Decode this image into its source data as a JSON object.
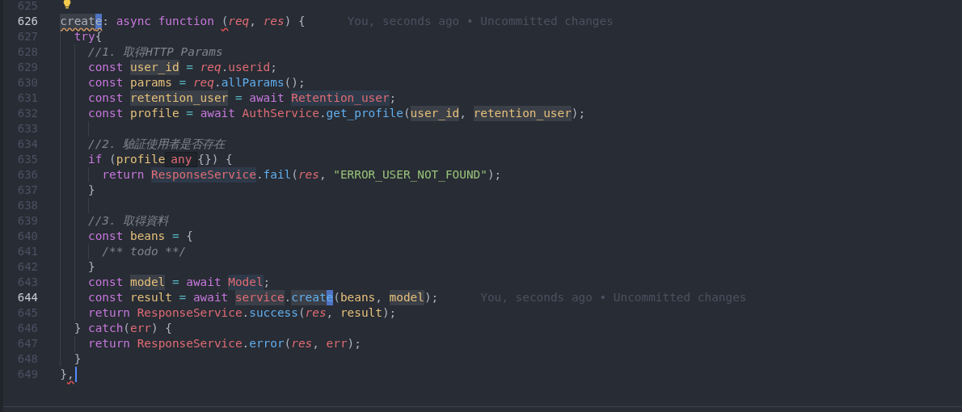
{
  "editor": {
    "lines": [
      {
        "number": "625",
        "current": false,
        "hint_icon": true
      },
      {
        "number": "626",
        "current": true,
        "tokens": [
          {
            "t": "  creat",
            "kind": "plain",
            "highlighted": true,
            "warning": true
          },
          {
            "t": "e",
            "kind": "plain",
            "selected": true,
            "warning": true
          },
          {
            "t": ": ",
            "kind": "plain"
          },
          {
            "t": "async ",
            "kind": "keyword"
          },
          {
            "t": "function ",
            "kind": "keyword"
          },
          {
            "t": "(",
            "kind": "plain",
            "error": true
          },
          {
            "t": "req",
            "kind": "param"
          },
          {
            "t": ", ",
            "kind": "plain"
          },
          {
            "t": "res",
            "kind": "param"
          },
          {
            "t": ") {",
            "kind": "plain"
          }
        ],
        "blame": "You, seconds ago • Uncommitted changes"
      },
      {
        "number": "627",
        "current": false,
        "tokens": [
          {
            "t": "    try",
            "kind": "keyword"
          },
          {
            "t": "{",
            "kind": "plain"
          }
        ]
      },
      {
        "number": "628",
        "current": false,
        "tokens": [
          {
            "t": "      //1. 取得HTTP Params",
            "kind": "comment"
          }
        ]
      },
      {
        "number": "629",
        "current": false,
        "tokens": [
          {
            "t": "      const ",
            "kind": "keyword"
          },
          {
            "t": "user_id",
            "kind": "variable",
            "highlighted": true
          },
          {
            "t": " = ",
            "kind": "operator"
          },
          {
            "t": "req",
            "kind": "param"
          },
          {
            "t": ".",
            "kind": "plain"
          },
          {
            "t": "userid",
            "kind": "property"
          },
          {
            "t": ";",
            "kind": "plain"
          }
        ]
      },
      {
        "number": "630",
        "current": false,
        "tokens": [
          {
            "t": "      const ",
            "kind": "keyword"
          },
          {
            "t": "params",
            "kind": "variable"
          },
          {
            "t": " = ",
            "kind": "operator"
          },
          {
            "t": "req",
            "kind": "param"
          },
          {
            "t": ".",
            "kind": "plain"
          },
          {
            "t": "allParams",
            "kind": "function"
          },
          {
            "t": "();",
            "kind": "plain"
          }
        ]
      },
      {
        "number": "631",
        "current": false,
        "tokens": [
          {
            "t": "      const ",
            "kind": "keyword"
          },
          {
            "t": "retention_user",
            "kind": "variable",
            "highlighted": true
          },
          {
            "t": " = ",
            "kind": "operator"
          },
          {
            "t": "await ",
            "kind": "keyword"
          },
          {
            "t": "Retention_user",
            "kind": "class",
            "highlighted": true
          },
          {
            "t": ";",
            "kind": "plain"
          }
        ]
      },
      {
        "number": "632",
        "current": false,
        "tokens": [
          {
            "t": "      const ",
            "kind": "keyword"
          },
          {
            "t": "profile",
            "kind": "variable"
          },
          {
            "t": " = ",
            "kind": "operator"
          },
          {
            "t": "await ",
            "kind": "keyword"
          },
          {
            "t": "AuthService",
            "kind": "class"
          },
          {
            "t": ".",
            "kind": "plain"
          },
          {
            "t": "get_profile",
            "kind": "function"
          },
          {
            "t": "(",
            "kind": "plain"
          },
          {
            "t": "user_id",
            "kind": "variable",
            "highlighted": true
          },
          {
            "t": ", ",
            "kind": "plain"
          },
          {
            "t": "retention_user",
            "kind": "variable",
            "highlighted": true
          },
          {
            "t": ");",
            "kind": "plain"
          }
        ]
      },
      {
        "number": "633",
        "current": false
      },
      {
        "number": "634",
        "current": false,
        "tokens": [
          {
            "t": "      //2. 驗証使用者是否存在",
            "kind": "comment"
          }
        ]
      },
      {
        "number": "635",
        "current": false,
        "tokens": [
          {
            "t": "      if ",
            "kind": "keyword"
          },
          {
            "t": "(",
            "kind": "plain"
          },
          {
            "t": "profile",
            "kind": "variable"
          },
          {
            "t": "any",
            "kind": "tooltip"
          },
          {
            "t": "{}) {",
            "kind": "plain"
          }
        ]
      },
      {
        "number": "636",
        "current": false,
        "tokens": [
          {
            "t": "        return ",
            "kind": "keyword"
          },
          {
            "t": "ResponseService",
            "kind": "class",
            "highlighted": true
          },
          {
            "t": ".",
            "kind": "plain"
          },
          {
            "t": "fail",
            "kind": "function"
          },
          {
            "t": "(",
            "kind": "plain"
          },
          {
            "t": "res",
            "kind": "param"
          },
          {
            "t": ", ",
            "kind": "plain"
          },
          {
            "t": "\"ERROR_USER_NOT_FOUND\"",
            "kind": "string"
          },
          {
            "t": ");",
            "kind": "plain"
          }
        ]
      },
      {
        "number": "637",
        "current": false,
        "tokens": [
          {
            "t": "      }",
            "kind": "plain"
          }
        ]
      },
      {
        "number": "638",
        "current": false
      },
      {
        "number": "639",
        "current": false,
        "tokens": [
          {
            "t": "      //3. 取得資料",
            "kind": "comment"
          }
        ]
      },
      {
        "number": "640",
        "current": false,
        "tokens": [
          {
            "t": "      const ",
            "kind": "keyword"
          },
          {
            "t": "beans",
            "kind": "variable"
          },
          {
            "t": " = ",
            "kind": "operator"
          },
          {
            "t": "{",
            "kind": "plain"
          }
        ]
      },
      {
        "number": "641",
        "current": false,
        "tokens": [
          {
            "t": "        /** todo **/",
            "kind": "comment"
          }
        ]
      },
      {
        "number": "642",
        "current": false,
        "tokens": [
          {
            "t": "      }",
            "kind": "plain"
          }
        ]
      },
      {
        "number": "643",
        "current": false,
        "tokens": [
          {
            "t": "      const ",
            "kind": "keyword"
          },
          {
            "t": "model",
            "kind": "variable",
            "highlighted": true
          },
          {
            "t": " = ",
            "kind": "operator"
          },
          {
            "t": "await ",
            "kind": "keyword"
          },
          {
            "t": "Model",
            "kind": "class",
            "highlighted": true
          },
          {
            "t": ";",
            "kind": "plain"
          }
        ]
      },
      {
        "number": "644",
        "current": true,
        "tokens": [
          {
            "t": "      const ",
            "kind": "keyword"
          },
          {
            "t": "result",
            "kind": "variable"
          },
          {
            "t": " = ",
            "kind": "operator"
          },
          {
            "t": "await ",
            "kind": "keyword"
          },
          {
            "t": "service",
            "kind": "property",
            "highlighted": true
          },
          {
            "t": ".",
            "kind": "plain"
          },
          {
            "t": "creat",
            "kind": "function",
            "highlighted": true
          },
          {
            "t": "e",
            "kind": "function",
            "selected": true
          },
          {
            "t": "(",
            "kind": "plain"
          },
          {
            "t": "beans",
            "kind": "variable"
          },
          {
            "t": ", ",
            "kind": "plain"
          },
          {
            "t": "model",
            "kind": "variable",
            "highlighted": true
          },
          {
            "t": ");",
            "kind": "plain"
          }
        ],
        "blame": "You, seconds ago • Uncommitted changes"
      },
      {
        "number": "645",
        "current": false,
        "tokens": [
          {
            "t": "      return ",
            "kind": "keyword"
          },
          {
            "t": "ResponseService",
            "kind": "class"
          },
          {
            "t": ".",
            "kind": "plain"
          },
          {
            "t": "success",
            "kind": "function"
          },
          {
            "t": "(",
            "kind": "plain"
          },
          {
            "t": "res",
            "kind": "param"
          },
          {
            "t": ", ",
            "kind": "plain"
          },
          {
            "t": "result",
            "kind": "variable"
          },
          {
            "t": ");",
            "kind": "plain"
          }
        ]
      },
      {
        "number": "646",
        "current": false,
        "tokens": [
          {
            "t": "    } ",
            "kind": "plain"
          },
          {
            "t": "catch",
            "kind": "keyword"
          },
          {
            "t": "(",
            "kind": "plain"
          },
          {
            "t": "err",
            "kind": "class"
          },
          {
            "t": ") {",
            "kind": "plain"
          }
        ]
      },
      {
        "number": "647",
        "current": false,
        "tokens": [
          {
            "t": "      return ",
            "kind": "keyword"
          },
          {
            "t": "ResponseService",
            "kind": "class"
          },
          {
            "t": ".",
            "kind": "plain"
          },
          {
            "t": "error",
            "kind": "function"
          },
          {
            "t": "(",
            "kind": "plain"
          },
          {
            "t": "res",
            "kind": "param"
          },
          {
            "t": ", ",
            "kind": "plain"
          },
          {
            "t": "err",
            "kind": "class"
          },
          {
            "t": ");",
            "kind": "plain"
          }
        ]
      },
      {
        "number": "648",
        "current": false,
        "tokens": [
          {
            "t": "    }",
            "kind": "plain"
          }
        ]
      },
      {
        "number": "649",
        "current": false,
        "cursor": true,
        "tokens": [
          {
            "t": "  }",
            "kind": "plain"
          },
          {
            "t": ",",
            "kind": "plain",
            "error": true
          }
        ]
      }
    ]
  }
}
